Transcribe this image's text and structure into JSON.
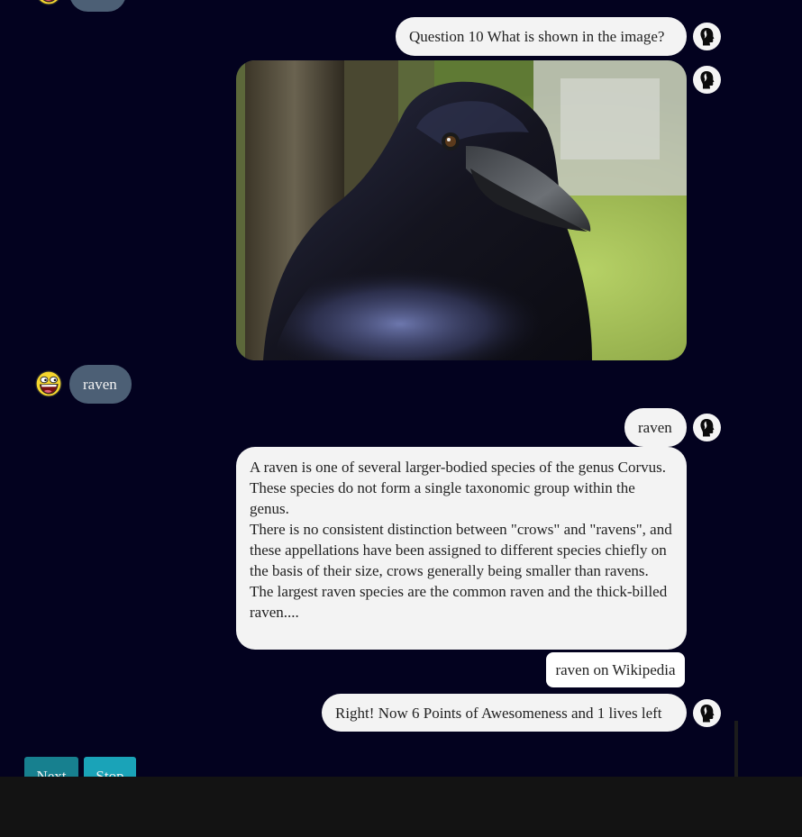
{
  "colors": {
    "page_background": "#03021f",
    "bot_bubble": "#f3f3f3",
    "user_bubble": "#4c5f75",
    "next_button": "#17808f",
    "stop_button": "#1aa3b8",
    "footer": "#131313"
  },
  "icons": {
    "bot_avatar": "head-silhouette-icon",
    "user_avatar": "awesome-face-icon"
  },
  "messages": {
    "question": "Question 10 What is shown in the image?",
    "user_answer": "raven",
    "bot_echo": "raven",
    "info_paragraphs": [
      "A raven is one of several larger-bodied species of the genus Corvus. These species do not form a single taxonomic group within the genus.",
      "There is no consistent distinction between \"crows\" and \"ravens\", and these appellations have been assigned to different species chiefly on the basis of their size, crows generally being smaller than ravens.",
      "The largest raven species are the common raven and the thick-billed raven...."
    ],
    "wiki_link": "raven on Wikipedia",
    "result": "Right! Now 6 Points of Awesomeness and 1 lives left"
  },
  "buttons": {
    "next": "Next",
    "stop": "Stop"
  }
}
